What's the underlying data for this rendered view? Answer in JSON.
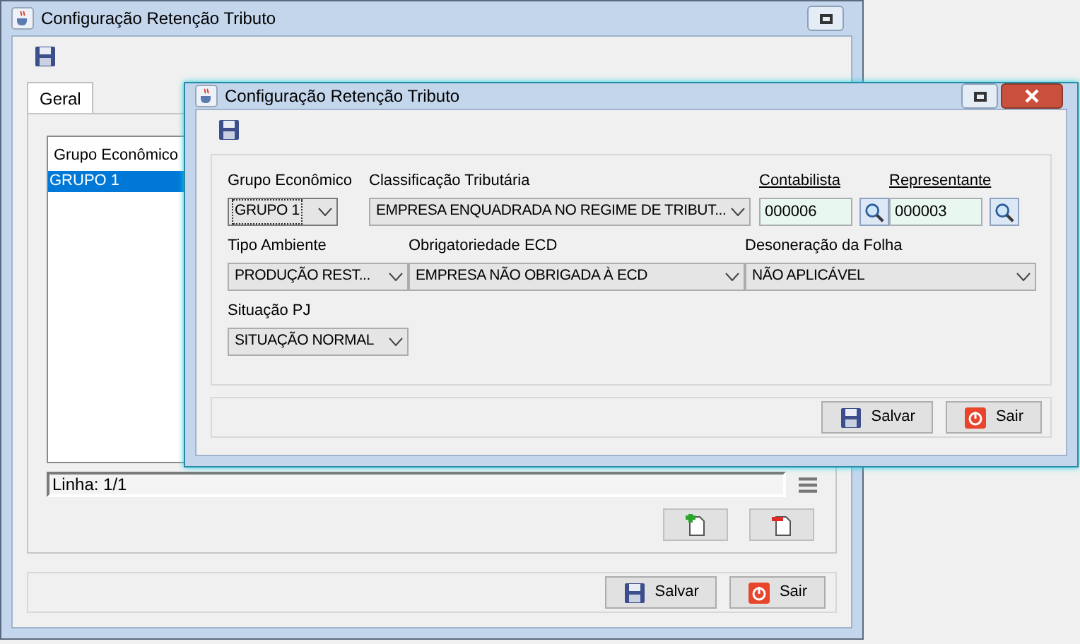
{
  "windows": [
    {
      "title": "Configuração Retenção Tributo",
      "tabs": [
        {
          "label": "Geral",
          "selected": true
        }
      ],
      "list": {
        "columns": [
          "Grupo Econômico"
        ],
        "rows": [
          {
            "cells": [
              "GRUPO 1"
            ],
            "selected": true
          }
        ]
      },
      "status": "Linha: 1/1",
      "buttons": [
        {
          "label": "Salvar",
          "kind": "save"
        },
        {
          "label": "Sair",
          "kind": "exit"
        }
      ]
    },
    {
      "title": "Configuração Retenção Tributo",
      "rows": [
        [
          {
            "kind": "combo",
            "label": "Grupo Econômico",
            "value": "GRUPO 1",
            "focused": true
          },
          {
            "kind": "combo",
            "label": "Classificação Tributária",
            "value": "EMPRESA ENQUADRADA NO REGIME DE TRIBUT...",
            "focused": false
          },
          {
            "kind": "lookup",
            "label": "Contabilista",
            "value": "000006"
          },
          {
            "kind": "lookup",
            "label": "Representante",
            "value": "000003"
          }
        ],
        [
          {
            "kind": "combo",
            "label": "Tipo Ambiente",
            "value": "PRODUÇÃO REST...",
            "focused": false
          },
          {
            "kind": "combo",
            "label": "Obrigatoriedade ECD",
            "value": "EMPRESA NÃO OBRIGADA À ECD",
            "focused": false
          },
          {
            "kind": "combo",
            "label": "Desoneração da Folha",
            "value": "NÃO APLICÁVEL",
            "focused": false
          }
        ],
        [
          {
            "kind": "combo",
            "label": "Situação PJ",
            "value": "SITUAÇÃO NORMAL",
            "focused": false
          }
        ]
      ],
      "buttons": [
        {
          "label": "Salvar",
          "kind": "save"
        },
        {
          "label": "Sair",
          "kind": "exit"
        }
      ]
    }
  ]
}
